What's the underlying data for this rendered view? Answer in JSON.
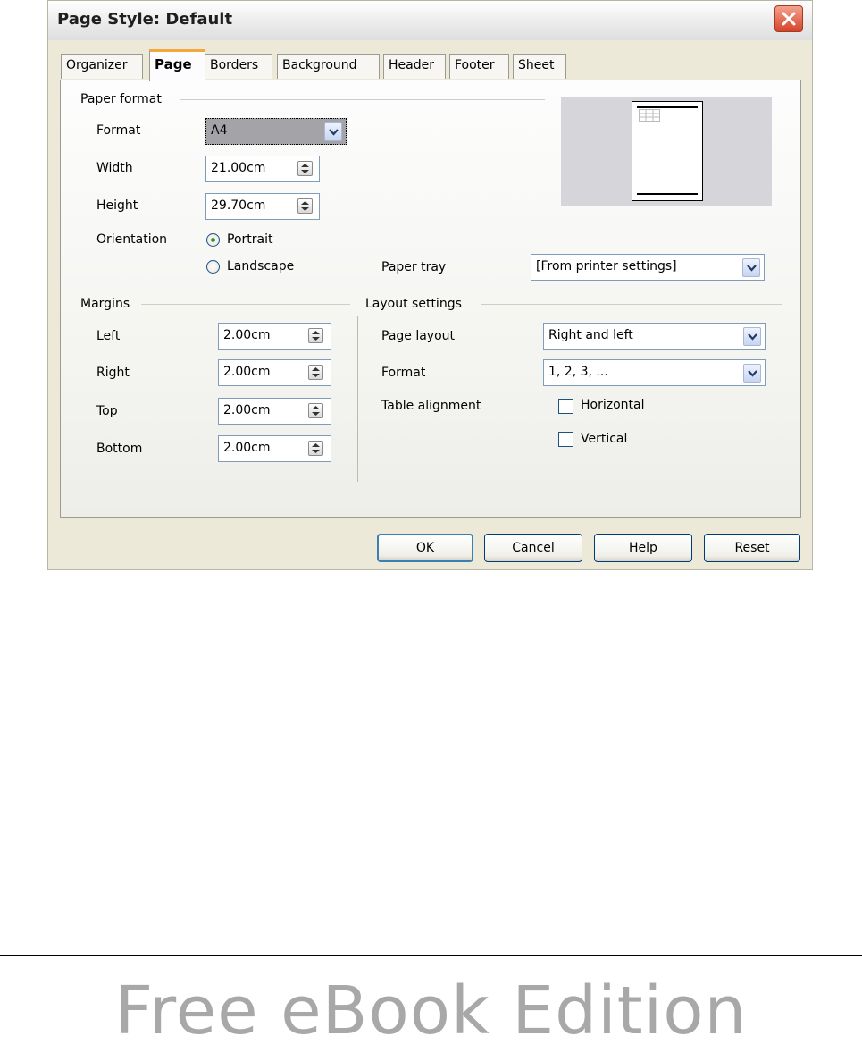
{
  "dialog": {
    "title": "Page Style: Default",
    "close_label": "×"
  },
  "tabs": [
    {
      "label": "Organizer",
      "active": false
    },
    {
      "label": "Page",
      "active": true
    },
    {
      "label": "Borders",
      "active": false
    },
    {
      "label": "Background",
      "active": false
    },
    {
      "label": "Header",
      "active": false
    },
    {
      "label": "Footer",
      "active": false
    },
    {
      "label": "Sheet",
      "active": false
    }
  ],
  "paper_format": {
    "group_label": "Paper format",
    "format_label": "Format",
    "format_value": "A4",
    "width_label": "Width",
    "width_value": "21.00cm",
    "height_label": "Height",
    "height_value": "29.70cm",
    "orientation_label": "Orientation",
    "portrait_label": "Portrait",
    "portrait_checked": true,
    "landscape_label": "Landscape",
    "landscape_checked": false,
    "paper_tray_label": "Paper tray",
    "paper_tray_value": "[From printer settings]"
  },
  "margins": {
    "group_label": "Margins",
    "left_label": "Left",
    "left_value": "2.00cm",
    "right_label": "Right",
    "right_value": "2.00cm",
    "top_label": "Top",
    "top_value": "2.00cm",
    "bottom_label": "Bottom",
    "bottom_value": "2.00cm"
  },
  "layout": {
    "group_label": "Layout settings",
    "page_layout_label": "Page layout",
    "page_layout_value": "Right and left",
    "format_label": "Format",
    "format_value": "1, 2, 3, ...",
    "table_alignment_label": "Table alignment",
    "horizontal_label": "Horizontal",
    "horizontal_checked": false,
    "vertical_label": "Vertical",
    "vertical_checked": false
  },
  "buttons": {
    "ok": "OK",
    "cancel": "Cancel",
    "help": "Help",
    "reset": "Reset"
  },
  "footer": {
    "watermark": "Free eBook Edition"
  },
  "colors": {
    "dialog_bg": "#ece9d8",
    "active_tab_accent": "#f2a83b",
    "close_button": "#d5442a"
  }
}
